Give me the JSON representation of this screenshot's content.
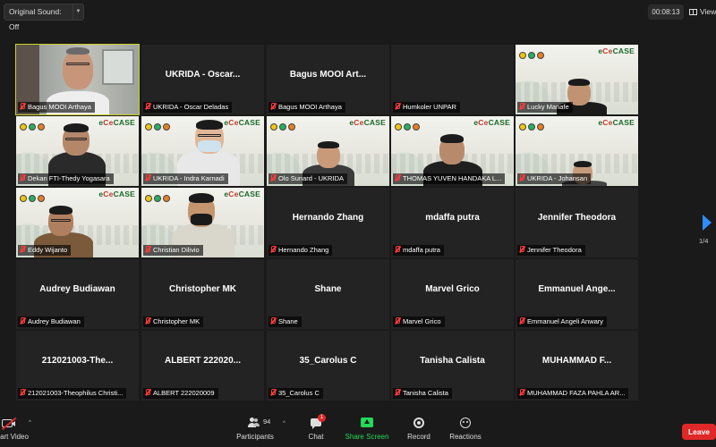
{
  "topbar": {
    "original_sound": "Original Sound: Off",
    "timer": "00:08:13",
    "view": "View"
  },
  "gallery": {
    "tiles": [
      {
        "tile_name": "",
        "label": "Bagus MOOI Arthaya",
        "video": true
      },
      {
        "tile_name": "UKRIDA - Oscar...",
        "label": "UKRIDA - Oscar Deladas",
        "video": false
      },
      {
        "tile_name": "Bagus MOOI Art...",
        "label": "Bagus MOOI Arthaya",
        "video": false
      },
      {
        "tile_name": "",
        "label": "Humkoler UNPAR",
        "video": false
      },
      {
        "tile_name": "",
        "label": "Lucky Manafe",
        "video": true
      },
      {
        "tile_name": "",
        "label": "Dekan FTI-Thedy Yogasara",
        "video": true
      },
      {
        "tile_name": "",
        "label": "UKRIDA - Indra Karnadi",
        "video": true
      },
      {
        "tile_name": "",
        "label": "Olo Sunard - UKRIDA",
        "video": true
      },
      {
        "tile_name": "",
        "label": "THOMAS YUVEN HANDAKA L...",
        "video": true
      },
      {
        "tile_name": "",
        "label": "UKRIDA - Johansan",
        "video": true
      },
      {
        "tile_name": "",
        "label": "Eddy Wijanto",
        "video": true
      },
      {
        "tile_name": "",
        "label": "Christian Dilivio",
        "video": true
      },
      {
        "tile_name": "Hernando Zhang",
        "label": "Hernando Zhang",
        "video": false
      },
      {
        "tile_name": "mdaffa putra",
        "label": "mdaffa putra",
        "video": false
      },
      {
        "tile_name": "Jennifer Theodora",
        "label": "Jennifer Theodora",
        "video": false
      },
      {
        "tile_name": "Audrey Budiawan",
        "label": "Audrey Budiawan",
        "video": false
      },
      {
        "tile_name": "Christopher MK",
        "label": "Christopher MK",
        "video": false
      },
      {
        "tile_name": "Shane",
        "label": "Shane",
        "video": false
      },
      {
        "tile_name": "Marvel Grico",
        "label": "Marvel Grico",
        "video": false
      },
      {
        "tile_name": "Emmanuel Ange...",
        "label": "Emmanuel Angeli Anwary",
        "video": false
      },
      {
        "tile_name": "212021003-The...",
        "label": "212021003-Theophilus Christi...",
        "video": false
      },
      {
        "tile_name": "ALBERT 222020...",
        "label": "ALBERT 222020009",
        "video": false
      },
      {
        "tile_name": "35_Carolus C",
        "label": "35_Carolus C",
        "video": false
      },
      {
        "tile_name": "Tanisha Calista",
        "label": "Tanisha Calista",
        "video": false
      },
      {
        "tile_name": "MUHAMMAD F...",
        "label": "MUHAMMAD FAZA PAHLA AR...",
        "video": false
      }
    ],
    "brand": {
      "prefix": "e",
      "ce": "Ce",
      "name": "CASE"
    },
    "page_indicator": "1/4"
  },
  "toolbar": {
    "video_label": "art Video",
    "participants_label": "Participants",
    "participants_count": "94",
    "chat_label": "Chat",
    "chat_badge": "1",
    "share_label": "Share Screen",
    "record_label": "Record",
    "reactions_label": "Reactions",
    "leave_label": "Leave"
  },
  "colors": {
    "accent_blue": "#2d8cff",
    "share_green": "#23d959",
    "leave_red": "#e02828",
    "active_speaker": "#c8d22a"
  }
}
